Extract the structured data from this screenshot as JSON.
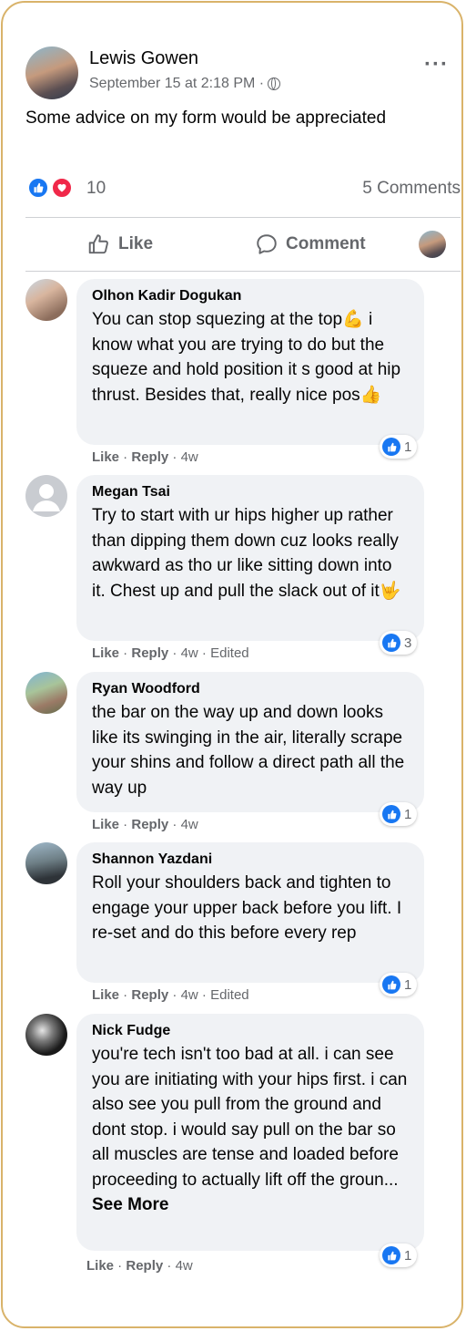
{
  "post": {
    "author": "Lewis Gowen",
    "timestamp": "September 15 at 2:18 PM ·",
    "privacy_icon": "globe-icon",
    "text": "Some advice on my form would be appreciated",
    "reaction_count": "10",
    "comments_count": "5 Comments",
    "reaction_icons": [
      "like-icon",
      "love-icon"
    ]
  },
  "actions": {
    "like_label": "Like",
    "comment_label": "Comment"
  },
  "comments": [
    {
      "name": "Olhon Kadir Dogukan",
      "text": "You can stop squezing at the top💪 i know what you are trying to do but the squeze and hold position it s good at hip thrust. Besides that, really nice pos👍",
      "like": "Like",
      "reply": "Reply",
      "time": "4w",
      "edited": "",
      "reactions": "1"
    },
    {
      "name": "Megan Tsai",
      "text": "Try to start with ur hips higher up rather than dipping them down cuz looks really awkward as tho ur like sitting down into it. Chest up and pull the slack out of it🤟",
      "like": "Like",
      "reply": "Reply",
      "time": "4w",
      "edited": "Edited",
      "reactions": "3"
    },
    {
      "name": "Ryan Woodford",
      "text": "the bar on the way up and down looks like its swinging in the air, literally scrape your shins and follow a direct path all the way up",
      "like": "Like",
      "reply": "Reply",
      "time": "4w",
      "edited": "",
      "reactions": "1"
    },
    {
      "name": "Shannon Yazdani",
      "text": "Roll your shoulders back and tighten to engage your upper back before you lift. I re-set and do this before every rep",
      "like": "Like",
      "reply": "Reply",
      "time": "4w",
      "edited": "Edited",
      "reactions": "1"
    },
    {
      "name": "Nick Fudge",
      "text": "you're tech isn't too bad at all. i can see you are initiating with your hips first. i can also see you pull from the ground and dont stop. i would say pull on the bar so all muscles are tense and loaded before proceeding to actually lift off the groun...",
      "see_more": "See More",
      "like": "Like",
      "reply": "Reply",
      "time": "4w",
      "edited": "",
      "reactions": "1"
    }
  ],
  "colors": {
    "accent": "#1877f2",
    "love": "#f02849",
    "bubble": "#f0f2f5",
    "muted": "#65676b",
    "frame_border": "#d9b36a"
  }
}
